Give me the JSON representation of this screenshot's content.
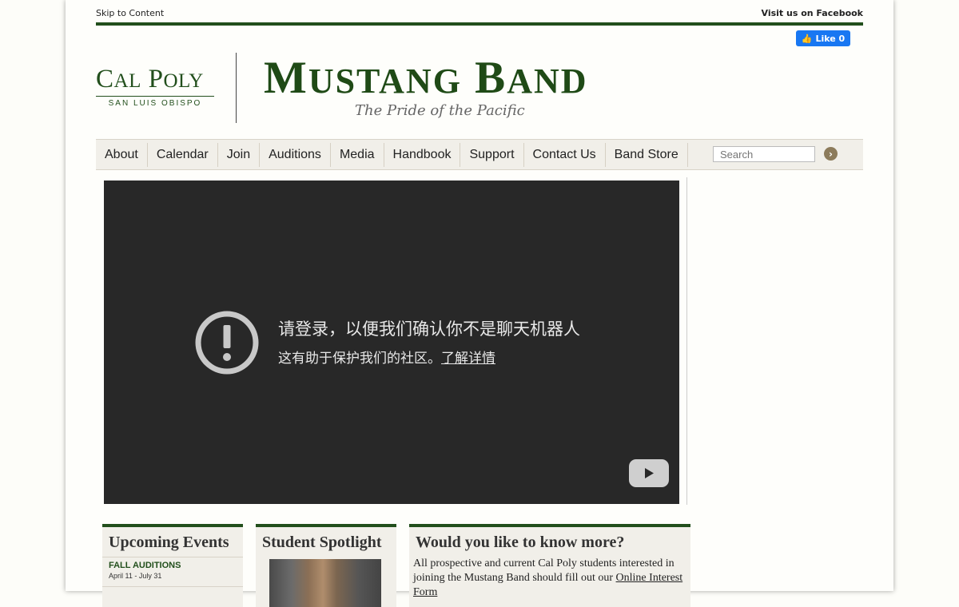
{
  "topbar": {
    "skip_label": "Skip to Content",
    "facebook_label": "Visit us on Facebook"
  },
  "facebook_like": {
    "label": "Like 0",
    "color": "#1877f2"
  },
  "brand": {
    "calpoly_c": "C",
    "calpoly_al": "AL",
    "calpoly_p": "P",
    "calpoly_oly": "OLY",
    "calpoly_sub": "SAN LUIS OBISPO",
    "title_m": "M",
    "title_ustang": "USTANG",
    "title_b": "B",
    "title_and": "AND",
    "subtitle": "The Pride of the Pacific",
    "color": "#224f1c"
  },
  "nav": {
    "items": [
      "About",
      "Calendar",
      "Join",
      "Auditions",
      "Media",
      "Handbook",
      "Support",
      "Contact Us",
      "Band Store"
    ],
    "search_placeholder": "Search",
    "search_go": "›"
  },
  "video": {
    "message_title": "请登录，以便我们确认你不是聊天机器人",
    "message_body": "这有助于保护我们的社区。",
    "message_link": "了解详情",
    "icon": "alert-circle-icon",
    "logo": "youtube-play-icon"
  },
  "panels": {
    "events": {
      "title": "Upcoming Events",
      "items": [
        {
          "name": "FALL AUDITIONS",
          "date": "April 11 - July 31"
        }
      ]
    },
    "spotlight": {
      "title": "Student Spotlight"
    },
    "more": {
      "title": "Would you like to know more?",
      "text": "All prospective and current Cal Poly students interested in joining the Mustang Band should fill out our ",
      "link": "Online Interest Form"
    }
  }
}
